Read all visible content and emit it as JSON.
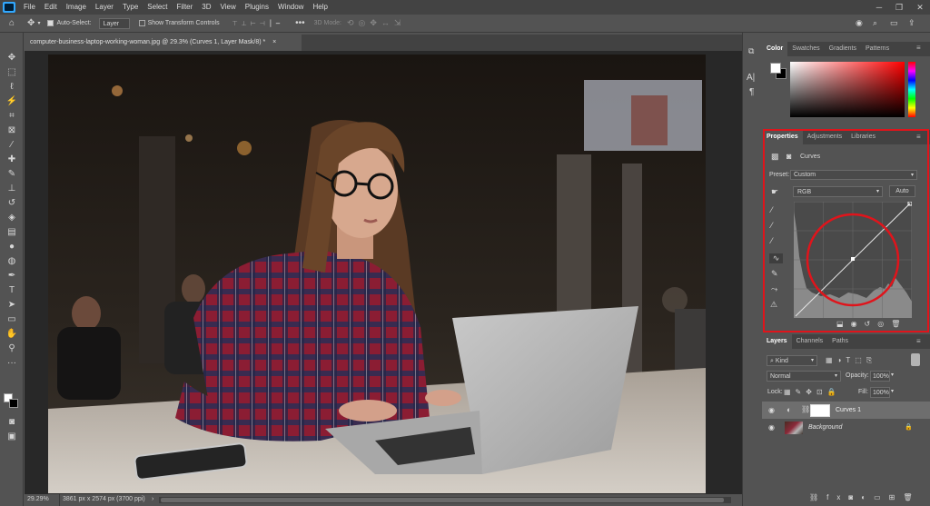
{
  "menu": {
    "items": [
      "File",
      "Edit",
      "Image",
      "Layer",
      "Type",
      "Select",
      "Filter",
      "3D",
      "View",
      "Plugins",
      "Window",
      "Help"
    ]
  },
  "options_bar": {
    "auto_select_label": "Auto-Select:",
    "auto_select_target": "Layer",
    "show_transform_label": "Show Transform Controls",
    "mode_3d_label": "3D Mode:"
  },
  "document": {
    "tab_title": "computer-business-laptop-working-woman.jpg @ 29.3% (Curves 1, Layer Mask/8) *",
    "tab_close": "×",
    "zoom": "29.29%",
    "doc_info": "3861 px x 2574 px (3700 ppi)"
  },
  "color_panel": {
    "tabs": [
      "Color",
      "Swatches",
      "Gradients",
      "Patterns"
    ]
  },
  "properties_panel": {
    "tabs": [
      "Properties",
      "Adjustments",
      "Libraries"
    ],
    "adjustment_name": "Curves",
    "preset_label": "Preset:",
    "preset_value": "Custom",
    "channel_value": "RGB",
    "auto_button": "Auto"
  },
  "layers_panel": {
    "tabs": [
      "Layers",
      "Channels",
      "Paths"
    ],
    "filter_kind": "Kind",
    "blend_mode": "Normal",
    "opacity_label": "Opacity:",
    "opacity_value": "100%",
    "lock_label": "Lock:",
    "fill_label": "Fill:",
    "fill_value": "100%",
    "layers": [
      {
        "name": "Curves 1"
      },
      {
        "name": "Background"
      }
    ]
  },
  "colors": {
    "highlight_red": "#e0141b",
    "accent_blue": "#31a8ff"
  }
}
